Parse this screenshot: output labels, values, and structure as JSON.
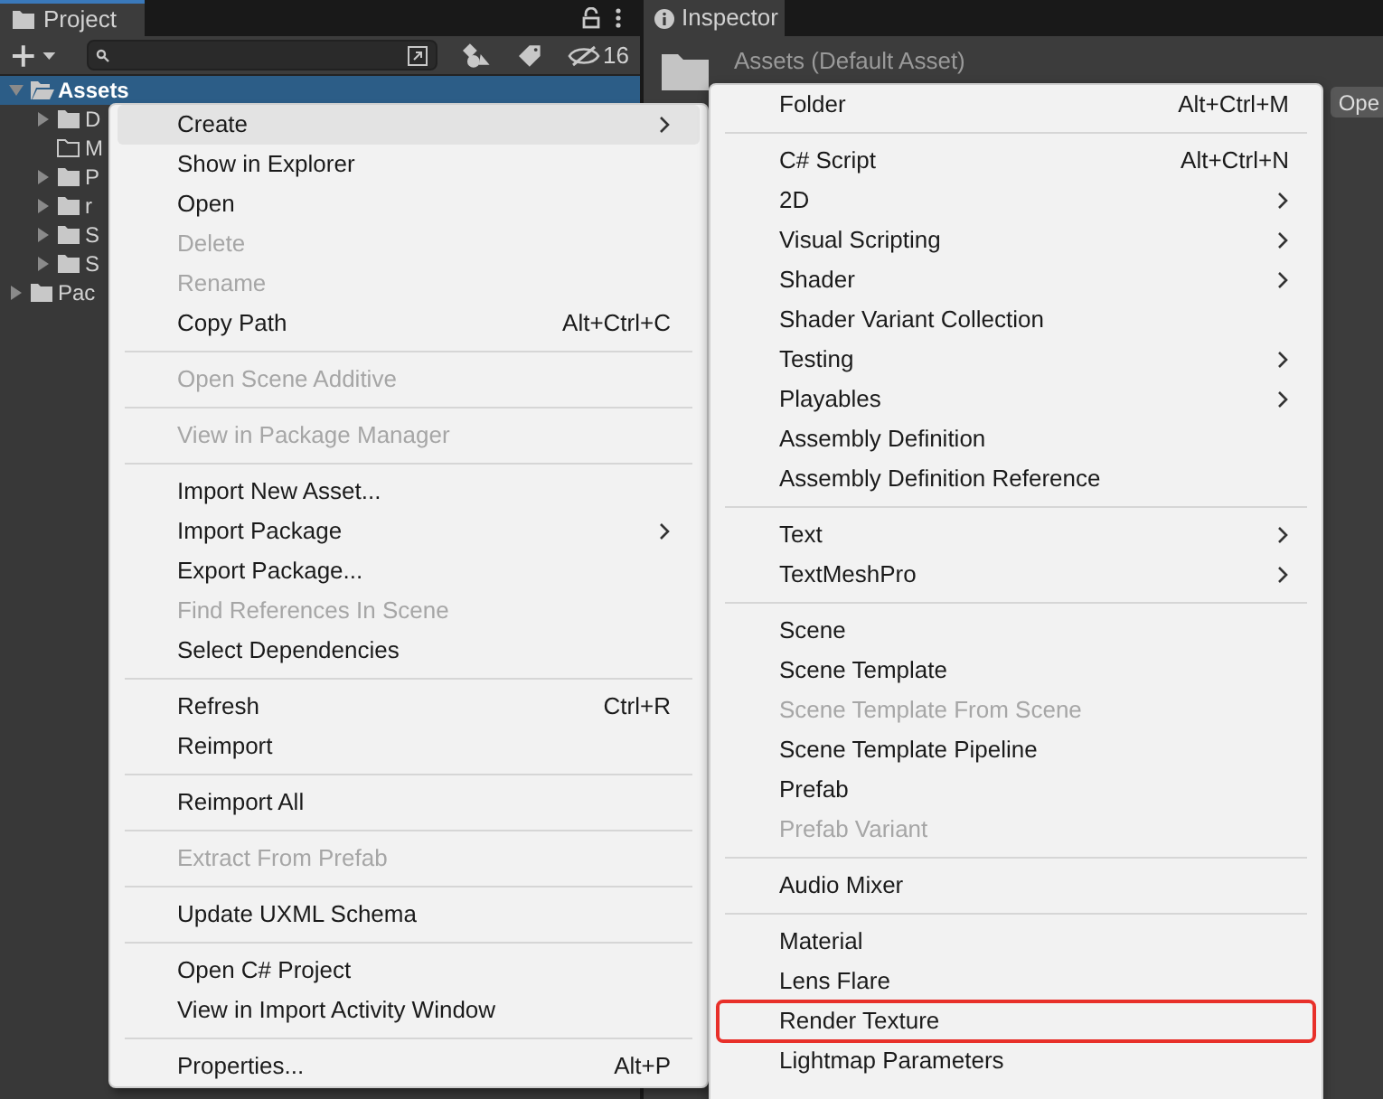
{
  "project_panel": {
    "tab": {
      "label": "Project",
      "selected": true
    },
    "hidden_count": "16",
    "tree": [
      {
        "kind": "folder",
        "label": "Assets",
        "selected": true,
        "expanded": true,
        "children": [
          {
            "kind": "folder",
            "label": "D",
            "selected": false,
            "expanded": false
          },
          {
            "kind": "empty_folder",
            "label": "M",
            "selected": false
          },
          {
            "kind": "folder",
            "label": "P",
            "selected": false,
            "expanded": false
          },
          {
            "kind": "folder",
            "label": "r",
            "selected": false,
            "expanded": false
          },
          {
            "kind": "folder",
            "label": "S",
            "selected": false,
            "expanded": false
          },
          {
            "kind": "folder",
            "label": "S",
            "selected": false,
            "expanded": false
          }
        ]
      },
      {
        "kind": "folder",
        "label": "Pac",
        "selected": false,
        "expanded": false
      }
    ]
  },
  "inspector_panel": {
    "tab": {
      "label": "Inspector",
      "selected": true
    },
    "title": "Assets (Default Asset)",
    "open_button": "Ope"
  },
  "context_menu": [
    {
      "kind": "item",
      "label": "Create",
      "submenu": true,
      "disabled": false,
      "highlighted": true
    },
    {
      "kind": "item",
      "label": "Show in Explorer",
      "disabled": false,
      "highlighted": false
    },
    {
      "kind": "item",
      "label": "Open",
      "disabled": false,
      "highlighted": false
    },
    {
      "kind": "item",
      "label": "Delete",
      "disabled": true,
      "highlighted": false
    },
    {
      "kind": "item",
      "label": "Rename",
      "disabled": true,
      "highlighted": false
    },
    {
      "kind": "item",
      "label": "Copy Path",
      "shortcut": "Alt+Ctrl+C",
      "disabled": false,
      "highlighted": false
    },
    {
      "kind": "separator"
    },
    {
      "kind": "item",
      "label": "Open Scene Additive",
      "disabled": true,
      "highlighted": false
    },
    {
      "kind": "separator"
    },
    {
      "kind": "item",
      "label": "View in Package Manager",
      "disabled": true,
      "highlighted": false
    },
    {
      "kind": "separator"
    },
    {
      "kind": "item",
      "label": "Import New Asset...",
      "disabled": false,
      "highlighted": false
    },
    {
      "kind": "item",
      "label": "Import Package",
      "submenu": true,
      "disabled": false,
      "highlighted": false
    },
    {
      "kind": "item",
      "label": "Export Package...",
      "disabled": false,
      "highlighted": false
    },
    {
      "kind": "item",
      "label": "Find References In Scene",
      "disabled": true,
      "highlighted": false
    },
    {
      "kind": "item",
      "label": "Select Dependencies",
      "disabled": false,
      "highlighted": false
    },
    {
      "kind": "separator"
    },
    {
      "kind": "item",
      "label": "Refresh",
      "shortcut": "Ctrl+R",
      "disabled": false,
      "highlighted": false
    },
    {
      "kind": "item",
      "label": "Reimport",
      "disabled": false,
      "highlighted": false
    },
    {
      "kind": "separator"
    },
    {
      "kind": "item",
      "label": "Reimport All",
      "disabled": false,
      "highlighted": false
    },
    {
      "kind": "separator"
    },
    {
      "kind": "item",
      "label": "Extract From Prefab",
      "disabled": true,
      "highlighted": false
    },
    {
      "kind": "separator"
    },
    {
      "kind": "item",
      "label": "Update UXML Schema",
      "disabled": false,
      "highlighted": false
    },
    {
      "kind": "separator"
    },
    {
      "kind": "item",
      "label": "Open C# Project",
      "disabled": false,
      "highlighted": false
    },
    {
      "kind": "item",
      "label": "View in Import Activity Window",
      "disabled": false,
      "highlighted": false
    },
    {
      "kind": "separator"
    },
    {
      "kind": "item",
      "label": "Properties...",
      "shortcut": "Alt+P",
      "disabled": false,
      "highlighted": false
    }
  ],
  "create_submenu": [
    {
      "kind": "item",
      "label": "Folder",
      "shortcut": "Alt+Ctrl+M",
      "disabled": false,
      "outlined": false
    },
    {
      "kind": "separator"
    },
    {
      "kind": "item",
      "label": "C# Script",
      "shortcut": "Alt+Ctrl+N",
      "disabled": false,
      "outlined": false
    },
    {
      "kind": "item",
      "label": "2D",
      "submenu": true,
      "disabled": false,
      "outlined": false
    },
    {
      "kind": "item",
      "label": "Visual Scripting",
      "submenu": true,
      "disabled": false,
      "outlined": false
    },
    {
      "kind": "item",
      "label": "Shader",
      "submenu": true,
      "disabled": false,
      "outlined": false
    },
    {
      "kind": "item",
      "label": "Shader Variant Collection",
      "disabled": false,
      "outlined": false
    },
    {
      "kind": "item",
      "label": "Testing",
      "submenu": true,
      "disabled": false,
      "outlined": false
    },
    {
      "kind": "item",
      "label": "Playables",
      "submenu": true,
      "disabled": false,
      "outlined": false
    },
    {
      "kind": "item",
      "label": "Assembly Definition",
      "disabled": false,
      "outlined": false
    },
    {
      "kind": "item",
      "label": "Assembly Definition Reference",
      "disabled": false,
      "outlined": false
    },
    {
      "kind": "separator"
    },
    {
      "kind": "item",
      "label": "Text",
      "submenu": true,
      "disabled": false,
      "outlined": false
    },
    {
      "kind": "item",
      "label": "TextMeshPro",
      "submenu": true,
      "disabled": false,
      "outlined": false
    },
    {
      "kind": "separator"
    },
    {
      "kind": "item",
      "label": "Scene",
      "disabled": false,
      "outlined": false
    },
    {
      "kind": "item",
      "label": "Scene Template",
      "disabled": false,
      "outlined": false
    },
    {
      "kind": "item",
      "label": "Scene Template From Scene",
      "disabled": true,
      "outlined": false
    },
    {
      "kind": "item",
      "label": "Scene Template Pipeline",
      "disabled": false,
      "outlined": false
    },
    {
      "kind": "item",
      "label": "Prefab",
      "disabled": false,
      "outlined": false
    },
    {
      "kind": "item",
      "label": "Prefab Variant",
      "disabled": true,
      "outlined": false
    },
    {
      "kind": "separator"
    },
    {
      "kind": "item",
      "label": "Audio Mixer",
      "disabled": false,
      "outlined": false
    },
    {
      "kind": "separator"
    },
    {
      "kind": "item",
      "label": "Material",
      "disabled": false,
      "outlined": false
    },
    {
      "kind": "item",
      "label": "Lens Flare",
      "disabled": false,
      "outlined": false
    },
    {
      "kind": "item",
      "label": "Render Texture",
      "disabled": false,
      "outlined": true
    },
    {
      "kind": "item",
      "label": "Lightmap Parameters",
      "disabled": false,
      "outlined": false
    }
  ]
}
